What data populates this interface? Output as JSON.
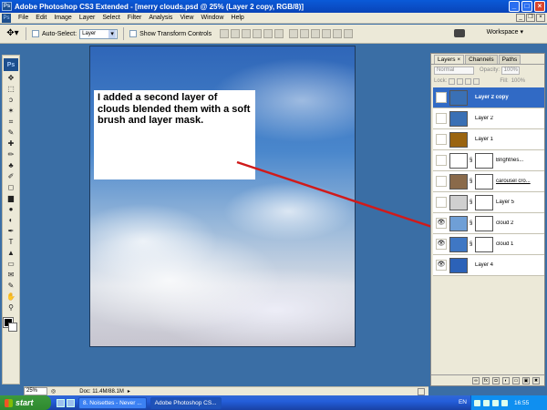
{
  "window": {
    "title": "Adobe Photoshop CS3 Extended - [merry clouds.psd @ 25% (Layer 2 copy, RGB/8)]",
    "ps_icon_label": "Ps"
  },
  "menu": [
    "File",
    "Edit",
    "Image",
    "Layer",
    "Select",
    "Filter",
    "Analysis",
    "View",
    "Window",
    "Help"
  ],
  "options_bar": {
    "auto_select_label": "Auto-Select:",
    "auto_select_value": "Layer",
    "transform_label": "Show Transform Controls",
    "workspace_label": "Workspace ▾"
  },
  "toolbox": {
    "badge": "Ps",
    "tools": [
      "move-icon",
      "marquee-icon",
      "lasso-icon",
      "magic-wand-icon",
      "crop-icon",
      "eyedropper-icon",
      "healing-icon",
      "brush-icon",
      "clone-stamp-icon",
      "history-brush-icon",
      "eraser-icon",
      "gradient-icon",
      "blur-icon",
      "dodge-icon",
      "pen-icon",
      "type-icon",
      "path-select-icon",
      "shape-icon",
      "notes-icon",
      "eyedropper2-icon",
      "hand-icon",
      "zoom-icon"
    ],
    "tool_glyphs": [
      "✥",
      "⬚",
      "ↄ",
      "✶",
      "⌗",
      "✎",
      "✚",
      "✏",
      "♣",
      "✐",
      "◻",
      "▆",
      "●",
      "◐",
      "✒",
      "T",
      "▲",
      "▭",
      "✉",
      "✎",
      "✋",
      "⚲"
    ]
  },
  "canvas": {
    "note_text": "I added a second layer of clouds blended them with a soft brush and layer mask."
  },
  "status_bar": {
    "zoom": "25%",
    "doc": "Doc: 11.4M/88.1M"
  },
  "layers_panel": {
    "tabs": [
      "Layers ×",
      "Channels",
      "Paths"
    ],
    "blend_mode": "Normal",
    "opacity_label": "Opacity:",
    "opacity_value": "100%",
    "lock_label": "Lock:",
    "fill_label": "Fill:",
    "fill_value": "100%",
    "layers": [
      {
        "name": "Layer 2 copy",
        "selected": true,
        "visible": false,
        "thumb_color": "#3a70b5",
        "has_mask": false
      },
      {
        "name": "Layer 2",
        "selected": false,
        "visible": false,
        "thumb_color": "#3a70b5",
        "has_mask": false
      },
      {
        "name": "Layer 1",
        "selected": false,
        "visible": false,
        "thumb_color": "#9a6410",
        "has_mask": false
      },
      {
        "name": "Brightnes...",
        "selected": false,
        "visible": false,
        "thumb_color": "#ffffff",
        "has_mask": true,
        "adjustment": true
      },
      {
        "name": "carousel cro...",
        "selected": false,
        "visible": false,
        "thumb_color": "#8a6a4a",
        "has_mask": true,
        "underline": true
      },
      {
        "name": "Layer 5",
        "selected": false,
        "visible": false,
        "thumb_color": "#cfcfcf",
        "has_mask": true
      },
      {
        "name": "cloud 2",
        "selected": false,
        "visible": true,
        "thumb_color": "#6f9fd6",
        "has_mask": true
      },
      {
        "name": "cloud 1",
        "selected": false,
        "visible": true,
        "thumb_color": "#3f77c4",
        "has_mask": true
      },
      {
        "name": "Layer 4",
        "selected": false,
        "visible": true,
        "thumb_color": "#2c62b8",
        "has_mask": false
      }
    ]
  },
  "taskbar": {
    "start": "start",
    "tasks": [
      "8. Noisettes - Never ...",
      "Adobe Photoshop CS..."
    ],
    "language": "EN",
    "clock": "16:55"
  },
  "colors": {
    "accent": "#316ac5",
    "arrow": "#d01a1a"
  }
}
